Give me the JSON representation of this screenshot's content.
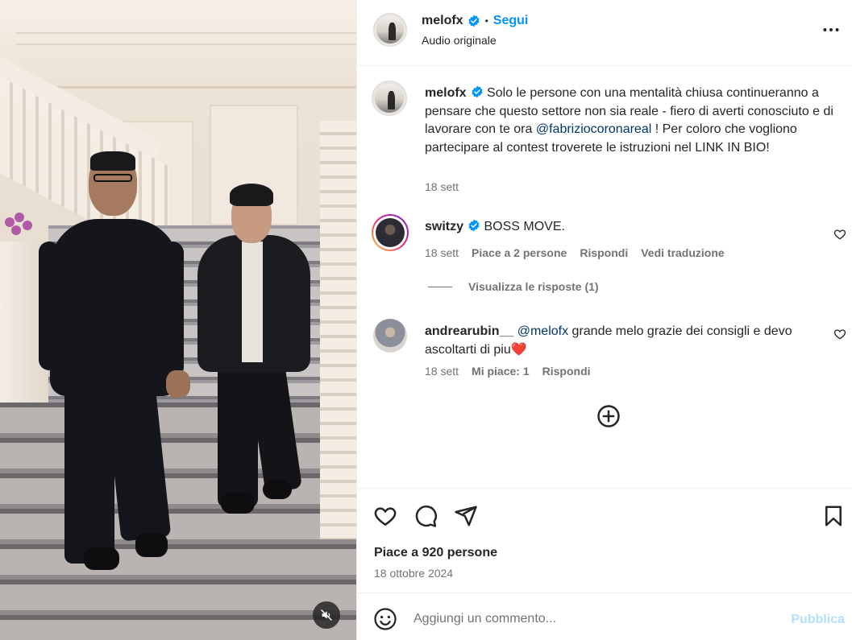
{
  "post": {
    "author": "melofx",
    "follow_label": "Segui",
    "audio_label": "Audio originale",
    "separator": "•"
  },
  "caption": {
    "username": "melofx",
    "text_before": " Solo le persone con una mentalità chiusa continueranno a pensare che questo settore non sia reale - fiero di averti conosciuto e di lavorare con te ora ",
    "mention": "@fabriziocoronareal",
    "text_after": " ! Per coloro che vogliono partecipare al contest troverete le istruzioni nel LINK IN BIO!",
    "date": "18 sett"
  },
  "comments": [
    {
      "username": "switzy",
      "text": " BOSS MOVE.",
      "date": "18 sett",
      "likes": "Piace a 2 persone",
      "reply": "Rispondi",
      "translate": "Vedi traduzione",
      "view_replies": "Visualizza le risposte (1)"
    },
    {
      "username": "andrearubin__",
      "mention": "@melofx",
      "text": " grande melo grazie dei consigli e devo ascoltarti di piu",
      "emoji": "❤️",
      "date": "18 sett",
      "likes": "Mi piace: 1",
      "reply": "Rispondi"
    }
  ],
  "footer": {
    "likes_text": "Piace a 920 persone",
    "date": "18 ottobre 2024",
    "comment_placeholder": "Aggiungi un commento...",
    "publish_label": "Pubblica"
  },
  "icons": {
    "verified": "verified-badge-icon",
    "more": "more-options-icon",
    "heart": "heart-icon",
    "comment": "comment-icon",
    "share": "share-icon",
    "save": "bookmark-icon",
    "emoji": "emoji-icon",
    "load_more": "plus-circle-icon",
    "mute": "muted-speaker-icon"
  },
  "colors": {
    "accent": "#0095f6",
    "mention": "#00376b",
    "publish_disabled": "#b2dffc",
    "secondary_text": "#737373",
    "verified": "#0095f6",
    "heart_emoji": "#e0245e"
  }
}
